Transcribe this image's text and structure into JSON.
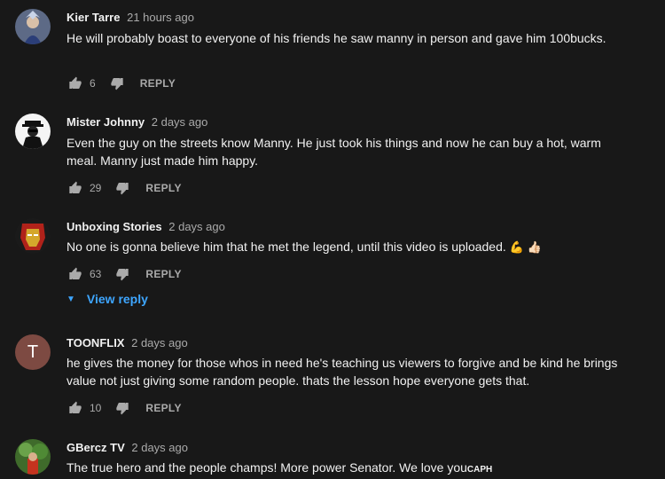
{
  "comments": [
    {
      "author": "Kier Tarre",
      "time": "21 hours ago",
      "text": "He will probably boast to everyone of his friends he saw manny in person and gave him 100bucks.",
      "likes": "6",
      "reply_label": "REPLY"
    },
    {
      "author": "Mister Johnny",
      "time": "2 days ago",
      "text": "Even the guy on the streets know Manny. He just took his things and now he can buy a hot, warm meal. Manny just made him happy.",
      "likes": "29",
      "reply_label": "REPLY"
    },
    {
      "author": "Unboxing Stories",
      "time": "2 days ago",
      "text": "No one is gonna believe him that he met the legend, until this video is uploaded.",
      "emoji": "💪 👍🏻",
      "likes": "63",
      "reply_label": "REPLY",
      "view_reply_label": "View reply"
    },
    {
      "author": "TOONFLIX",
      "time": "2 days ago",
      "avatar_letter": "T",
      "text": "he gives the money for those whos in need he's teaching us viewers to forgive and be kind he brings value not just giving some random people. thats the lesson hope everyone gets that.",
      "likes": "10",
      "reply_label": "REPLY"
    },
    {
      "author": "GBercz TV",
      "time": "2 days ago",
      "text": "The true hero and the people champs! More power Senator. We love you",
      "text_suffix": "CAPH"
    }
  ],
  "colors": {
    "background": "#181818",
    "text": "#f1f1f1",
    "secondary": "#aaaaaa",
    "link": "#3ea6ff",
    "letter_avatar": "#7d4a42"
  },
  "icons": [
    "thumbs-up-icon",
    "thumbs-down-icon",
    "chevron-down-icon"
  ]
}
